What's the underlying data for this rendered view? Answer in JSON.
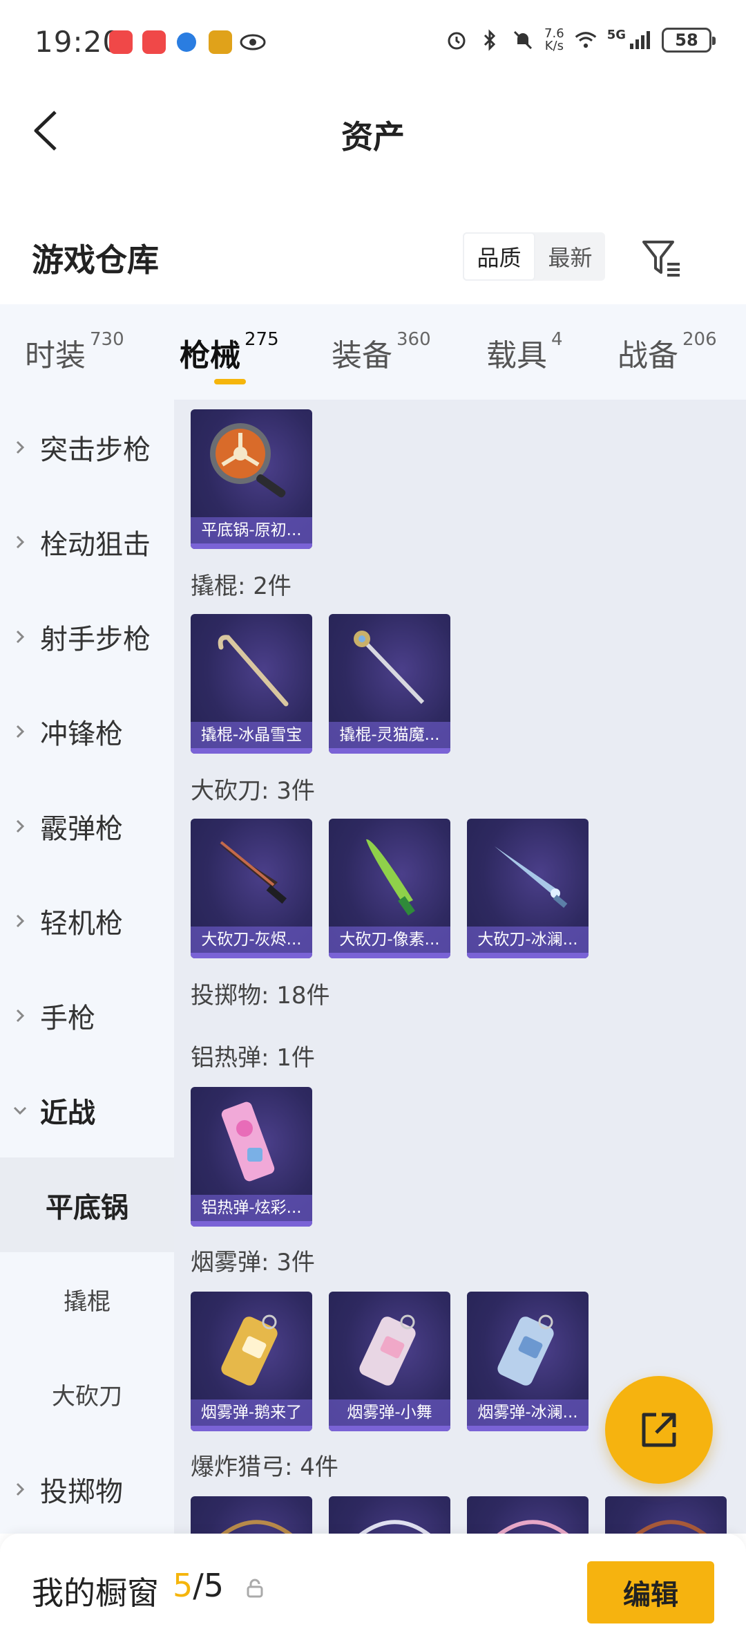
{
  "status_bar": {
    "time": "19:20",
    "net_speed_value": "7.6",
    "net_speed_unit": "K/s",
    "network": "5G",
    "battery": "58"
  },
  "header": {
    "title": "资产"
  },
  "warehouse": {
    "title": "游戏仓库",
    "sort_quality": "品质",
    "sort_newest": "最新"
  },
  "tabs": [
    {
      "label": "时装",
      "count": "730"
    },
    {
      "label": "枪械",
      "count": "275"
    },
    {
      "label": "装备",
      "count": "360"
    },
    {
      "label": "载具",
      "count": "4"
    },
    {
      "label": "战备",
      "count": "206"
    }
  ],
  "sidebar": {
    "items": [
      {
        "label": "突击步枪"
      },
      {
        "label": "栓动狙击"
      },
      {
        "label": "射手步枪"
      },
      {
        "label": "冲锋枪"
      },
      {
        "label": "霰弹枪"
      },
      {
        "label": "轻机枪"
      },
      {
        "label": "手枪"
      },
      {
        "label": "近战"
      }
    ],
    "sub_items": [
      {
        "label": "平底锅"
      },
      {
        "label": "撬棍"
      },
      {
        "label": "大砍刀"
      }
    ],
    "last_item": {
      "label": "投掷物"
    }
  },
  "content": {
    "pan_cards": [
      {
        "name": "平底锅-原初..."
      }
    ],
    "groups": [
      {
        "title": "撬棍: 2件",
        "cards": [
          {
            "name": "撬棍-冰晶雪宝"
          },
          {
            "name": "撬棍-灵猫魔..."
          }
        ]
      },
      {
        "title": "大砍刀: 3件",
        "cards": [
          {
            "name": "大砍刀-灰烬..."
          },
          {
            "name": "大砍刀-像素..."
          },
          {
            "name": "大砍刀-冰澜..."
          }
        ]
      },
      {
        "title": "投掷物: 18件"
      },
      {
        "title": "铝热弹: 1件",
        "cards": [
          {
            "name": "铝热弹-炫彩..."
          }
        ]
      },
      {
        "title": "烟雾弹: 3件",
        "cards": [
          {
            "name": "烟雾弹-鹅来了"
          },
          {
            "name": "烟雾弹-小舞"
          },
          {
            "name": "烟雾弹-冰澜..."
          }
        ]
      },
      {
        "title": "爆炸猎弓: 4件"
      }
    ]
  },
  "bottom_bar": {
    "title": "我的橱窗",
    "current": "5",
    "total": "/5",
    "edit_label": "编辑"
  },
  "colors": {
    "accent": "#f6b30f",
    "card_bg": "#2e2960",
    "card_label_bar": "#7a63d6",
    "sidebar_bg": "#f4f7fc",
    "content_bg": "#e9ecf3"
  }
}
